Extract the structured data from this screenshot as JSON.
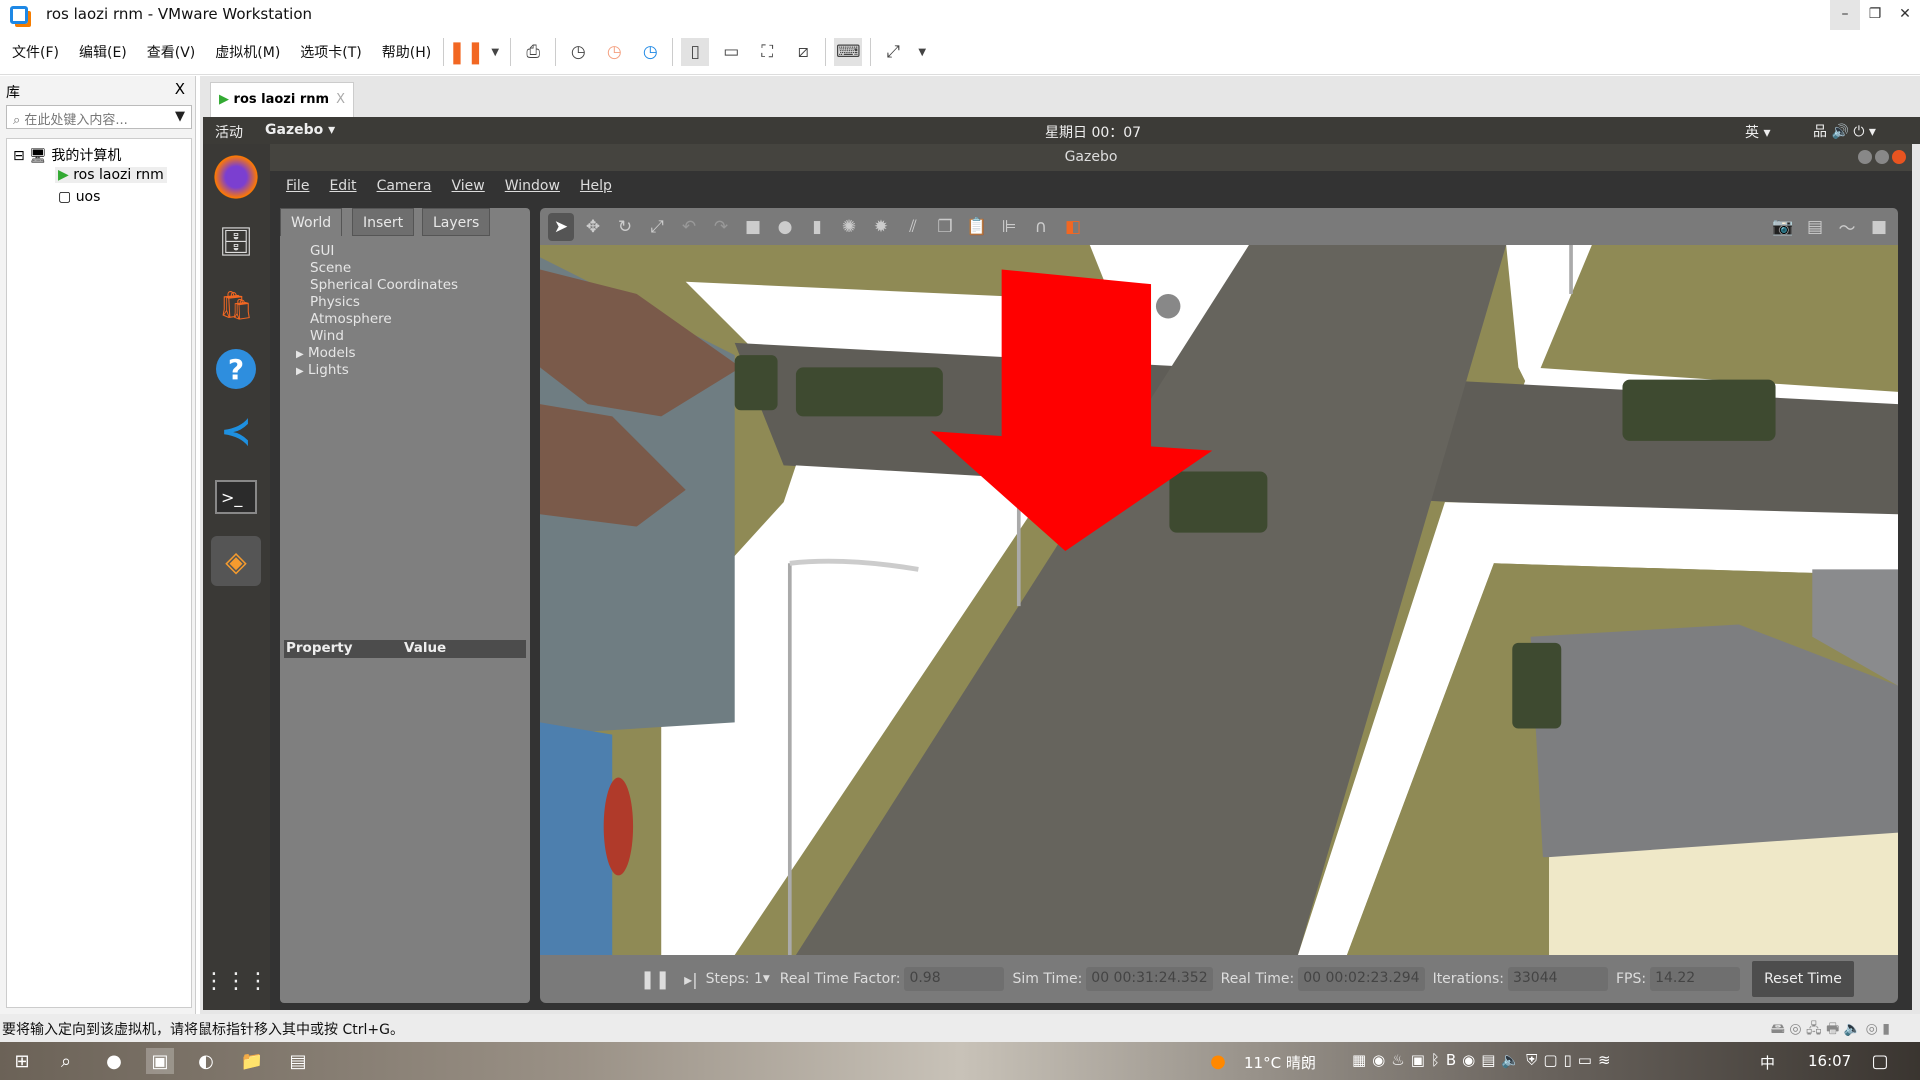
{
  "window": {
    "title": "ros laozi rnm - VMware Workstation",
    "controls": [
      "–",
      "❐",
      "✕"
    ]
  },
  "vm_menu": [
    "文件(F)",
    "编辑(E)",
    "查看(V)",
    "虚拟机(M)",
    "选项卡(T)",
    "帮助(H)"
  ],
  "library": {
    "title": "库",
    "close": "X",
    "search_placeholder": "在此处键入内容...",
    "tree": {
      "root": "我的计算机",
      "items": [
        "ros laozi rnm",
        "uos"
      ]
    }
  },
  "vm_tab": {
    "label": "ros laozi rnm",
    "close": "X"
  },
  "ubuntu_bar": {
    "activities": "活动",
    "app": "Gazebo ▾",
    "clock": "星期日 00：07",
    "input_method": "英 ▾"
  },
  "dock": [
    "firefox-icon",
    "files-icon",
    "software-icon",
    "help-icon",
    "vscode-icon",
    "terminal-icon",
    "gazebo-icon",
    "apps-grid-icon"
  ],
  "gazebo": {
    "title": "Gazebo",
    "menu": [
      "File",
      "Edit",
      "Camera",
      "View",
      "Window",
      "Help"
    ],
    "tabs": [
      "World",
      "Insert",
      "Layers"
    ],
    "world_items": [
      "GUI",
      "Scene",
      "Spherical Coordinates",
      "Physics",
      "Atmosphere",
      "Wind",
      "Models",
      "Lights"
    ],
    "property_header": "Property",
    "value_header": "Value",
    "bottom": {
      "steps_label": "Steps:",
      "steps": "1",
      "rtf_label": "Real Time Factor:",
      "rtf": "0.98",
      "sim_label": "Sim Time:",
      "sim": "00 00:31:24.352",
      "real_label": "Real Time:",
      "real": "00 00:02:23.294",
      "iter_label": "Iterations:",
      "iter": "33044",
      "fps_label": "FPS:",
      "fps": "14.22",
      "reset": "Reset Time"
    }
  },
  "status_text": "要将输入定向到该虚拟机，请将鼠标指针移入其中或按 Ctrl+G。",
  "taskbar": {
    "weather": "11°C 晴朗",
    "ime": "中",
    "time": "16:07"
  },
  "colors": {
    "accent_orange": "#f26722",
    "arrow_red": "#ff0000",
    "gazebo_panel": "#7f7f7f"
  }
}
